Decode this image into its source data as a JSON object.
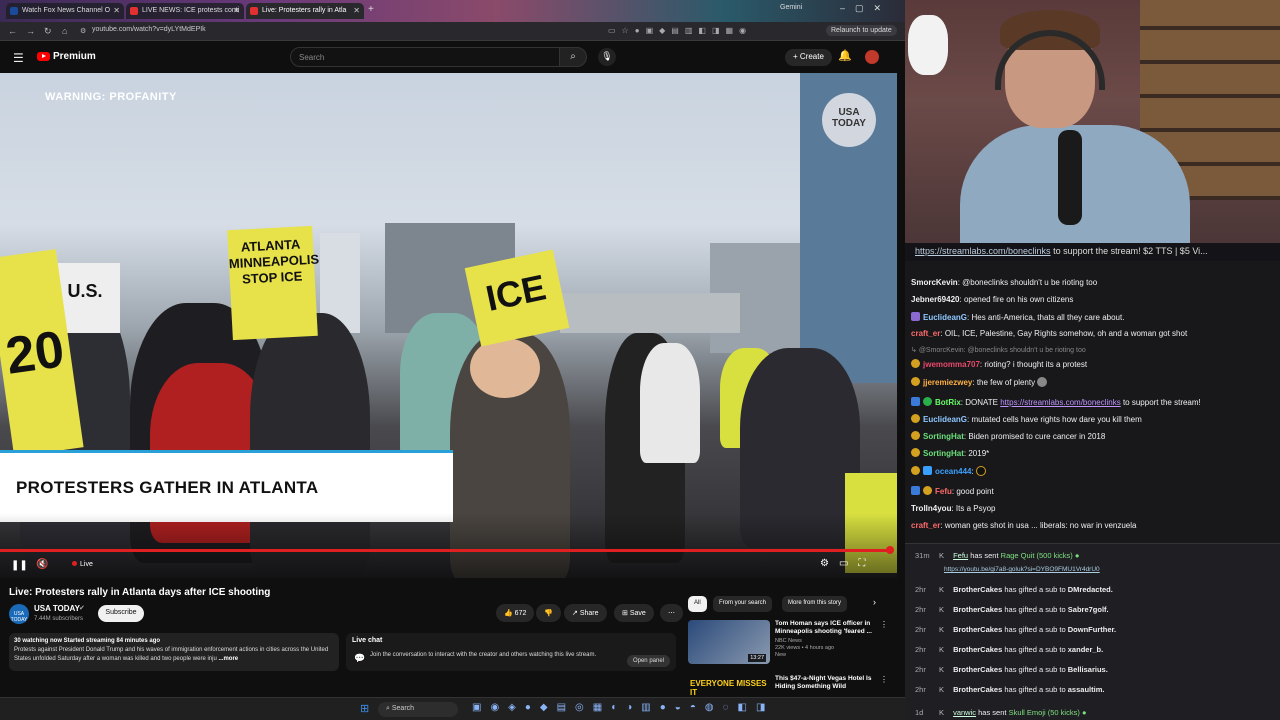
{
  "browser": {
    "tabs": [
      {
        "label": "Watch Fox News Channel O"
      },
      {
        "label": "LIVE NEWS: ICE protests conti"
      },
      {
        "label": "Live: Protesters rally in Atla"
      }
    ],
    "gemini_label": "Gemini",
    "url": "youtube.com/watch?v=dyLYtMdEPIk",
    "relaunch_label": "Relaunch to update"
  },
  "youtube": {
    "brand": "Premium",
    "search_placeholder": "Search",
    "create_label": "Create",
    "video": {
      "warning": "WARNING: PROFANITY",
      "logo_text": "USA TODAY",
      "lower_third": "PROTESTERS GATHER IN ATLANTA",
      "live_label": "Live",
      "signs": [
        "ATLANTA MINNEAPOLIS STOP ICE",
        "ICE",
        "U.S.",
        "20"
      ]
    },
    "title": "Live: Protesters rally in Atlanta days after ICE shooting",
    "channel": {
      "name": "USA TODAY",
      "avatar_text": "USA TODAY",
      "subscribers": "7.44M subscribers",
      "subscribe_label": "Subscribe"
    },
    "actions": {
      "like_count": "672",
      "share_label": "Share",
      "save_label": "Save"
    },
    "description": {
      "stats": "30 watching now  Started streaming 84 minutes ago",
      "text": "Protests against President Donald Trump and his waves of immigration enforcement actions in cities across the United States unfolded Saturday after a woman was killed and two people were inju",
      "more": "...more"
    },
    "live_chat": {
      "title": "Live chat",
      "text": "Join the conversation to interact with the creator and others watching this live stream.",
      "open_panel": "Open panel"
    },
    "chips": [
      "All",
      "From your search",
      "More from this story"
    ],
    "recommendations": [
      {
        "title": "Tom Homan says ICE officer in Minneapolis shooting 'feared ...",
        "channel": "NBC News",
        "meta": "22K views • 4 hours ago",
        "badge": "New",
        "duration": "13:27"
      },
      {
        "title": "This $47-a-Night Vegas Hotel Is Hiding Something Wild",
        "thumb_text": "EVERYONE MISSES IT"
      }
    ]
  },
  "taskbar": {
    "search_label": "Search"
  },
  "stream": {
    "banner_link": "https://streamlabs.com/boneclinks",
    "banner_text": "to support the stream! $2 TTS | $5 Vi...",
    "chat": [
      {
        "user": "SmorcKevin",
        "text": "@boneclinks shouldn't u be rioting too",
        "color": "#efeff1"
      },
      {
        "user": "Jebner69420",
        "text": "opened fire on his own citizens",
        "color": "#efeff1"
      },
      {
        "user": "EuclideanG",
        "text": "Hes anti-America, thats all they care about.",
        "color": "#8fc8ff"
      },
      {
        "user": "craft_er",
        "text": "OIL, ICE, Palestine, Gay Rights somehow, oh and a woman got shot",
        "color": "#ff6a6a"
      },
      {
        "user": "jwemomma707",
        "text": "rioting? i thought its a protest",
        "color": "#e84a6a",
        "reply": "@SmorcKevin: @boneclinks shouldn't u be rioting too"
      },
      {
        "user": "jjeremiezwey",
        "text": "the few of plenty",
        "color": "#ffb040"
      },
      {
        "user": "BotRix",
        "text": "DONATE",
        "link": "https://streamlabs.com/boneclinks",
        "tail": "to support the stream!",
        "color": "#6aff6a"
      },
      {
        "user": "EuclideanG",
        "text": "mutated cells have rights how dare you kill them",
        "color": "#8fc8ff"
      },
      {
        "user": "SortingHat",
        "text": "Biden promised to cure cancer in 2018",
        "color": "#6ae07a"
      },
      {
        "user": "SortingHat",
        "text": "2019*",
        "color": "#6ae07a"
      },
      {
        "user": "ocean444",
        "text": "",
        "color": "#3aa0ff"
      },
      {
        "user": "Fefu",
        "text": "good point",
        "color": "#ff6a6a"
      },
      {
        "user": "Trolln4you",
        "text": "Its a Psyop",
        "color": "#efeff1"
      },
      {
        "user": "craft_er",
        "text": "woman gets shot in usa ... liberals: no war in venzuela",
        "color": "#ff6a6a"
      }
    ],
    "events": [
      {
        "time": "31m",
        "user": "Fefu",
        "action": "has sent",
        "highlight": "Rage Quit (500 kicks)",
        "link": "https://youtu.be/gi7a8-goluk?si=DYBO9FMU1Vr4drU0"
      },
      {
        "time": "2hr",
        "user": "BrotherCakes",
        "action": "has gifted a sub to",
        "target": "DMredacted."
      },
      {
        "time": "2hr",
        "user": "BrotherCakes",
        "action": "has gifted a sub to",
        "target": "Sabre7golf."
      },
      {
        "time": "2hr",
        "user": "BrotherCakes",
        "action": "has gifted a sub to",
        "target": "DownFurther."
      },
      {
        "time": "2hr",
        "user": "BrotherCakes",
        "action": "has gifted a sub to",
        "target": "xander_b."
      },
      {
        "time": "2hr",
        "user": "BrotherCakes",
        "action": "has gifted a sub to",
        "target": "Bellisarius."
      },
      {
        "time": "2hr",
        "user": "BrotherCakes",
        "action": "has gifted a sub to",
        "target": "assaultim."
      },
      {
        "time": "1d",
        "user": "vanwic",
        "action": "has sent",
        "highlight": "Skull Emoji (50 kicks)"
      }
    ]
  },
  "colors": {
    "youtube_red": "#ff0000",
    "sign_yellow": "#e7e14a",
    "lower_third_accent": "#2aa0d8"
  }
}
